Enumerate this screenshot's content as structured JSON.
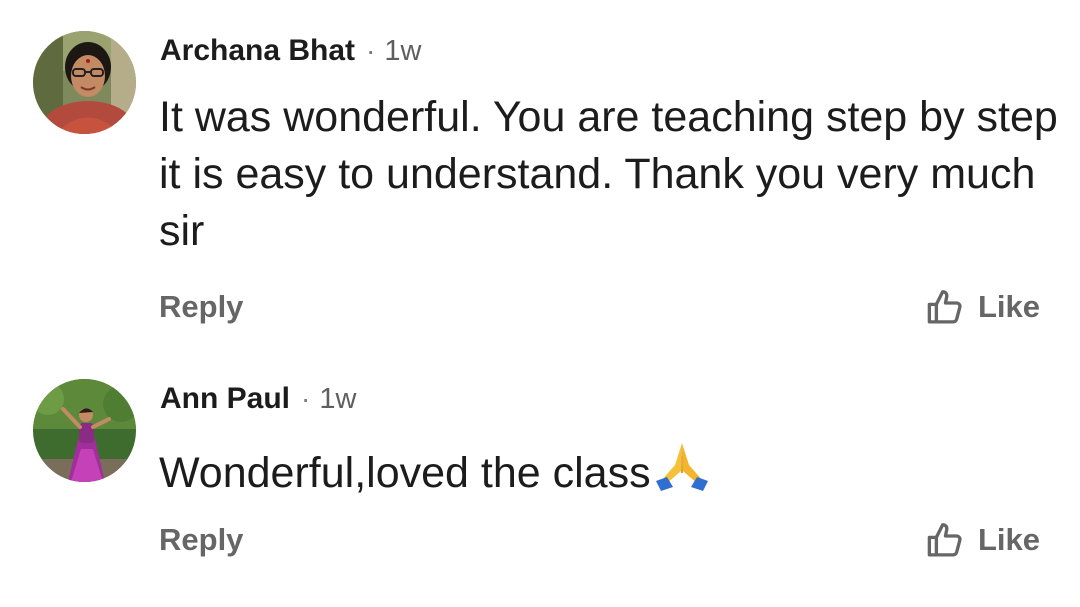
{
  "comments": [
    {
      "author": "Archana Bhat",
      "separator": "·",
      "time": "1w",
      "text": "It was wonderful. You are teaching step by step it is easy to understand. Thank you very much sir",
      "reply_label": "Reply",
      "like_label": "Like",
      "avatar_icon": "profile-photo-woman-glasses"
    },
    {
      "author": "Ann Paul",
      "separator": "·",
      "time": "1w",
      "text": "Wonderful,loved the class",
      "emoji": "folded-hands-emoji",
      "reply_label": "Reply",
      "like_label": "Like",
      "avatar_icon": "profile-photo-dancer"
    }
  ],
  "colors": {
    "text_primary": "#1c1c1c",
    "text_secondary": "#666666",
    "background": "#ffffff"
  }
}
